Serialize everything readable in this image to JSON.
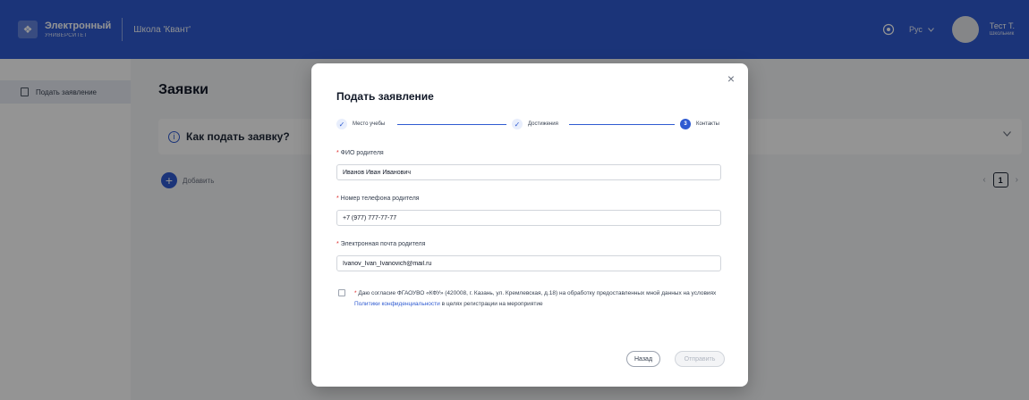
{
  "header": {
    "logo_line1": "Электронный",
    "logo_line2": "УНИВЕРСИТЕТ",
    "org_name": "Школа 'Квант'",
    "language": "Рус",
    "user_name": "Тест Т.",
    "user_role": "Школьник",
    "icons": [
      "eye-icon",
      "chevron-down-icon",
      "avatar"
    ],
    "accent_color": "#2f5bd1"
  },
  "sidebar": {
    "items": [
      {
        "label": "Подать заявление",
        "icon": "document-icon",
        "active": true
      }
    ]
  },
  "main": {
    "title": "Заявки",
    "howto": "Как подать заявку?",
    "add_label": "Добавить",
    "pager": {
      "current": "1",
      "prev": "‹",
      "next": "›"
    }
  },
  "modal": {
    "title": "Подать заявление",
    "close": "×",
    "steps": [
      {
        "label": "Место учебы",
        "state": "done",
        "marker": "✓"
      },
      {
        "label": "Достижения",
        "state": "done",
        "marker": "✓"
      },
      {
        "label": "Контакты",
        "state": "active",
        "marker": "3"
      }
    ],
    "fields": [
      {
        "label": "ФИО родителя",
        "value": "Иванов Иван Иванович"
      },
      {
        "label": "Номер телефона родителя",
        "value": "+7 (977) 777-77-77"
      },
      {
        "label": "Электронная почта родителя",
        "value": "Ivanov_Ivan_Ivanovich@mail.ru"
      }
    ],
    "consent": {
      "text_before": "Даю согласие ФГАОУВО «КФУ» (420008, г. Казань, ул. Кремлевская, д.18) на обработку предоставленных мной данных на условиях ",
      "link": "Политики конфиденциальности",
      "text_after": " в целях регистрации на мероприятие",
      "checked": false
    },
    "back_label": "Назад",
    "submit_label": "Отправить",
    "submit_disabled": true
  }
}
